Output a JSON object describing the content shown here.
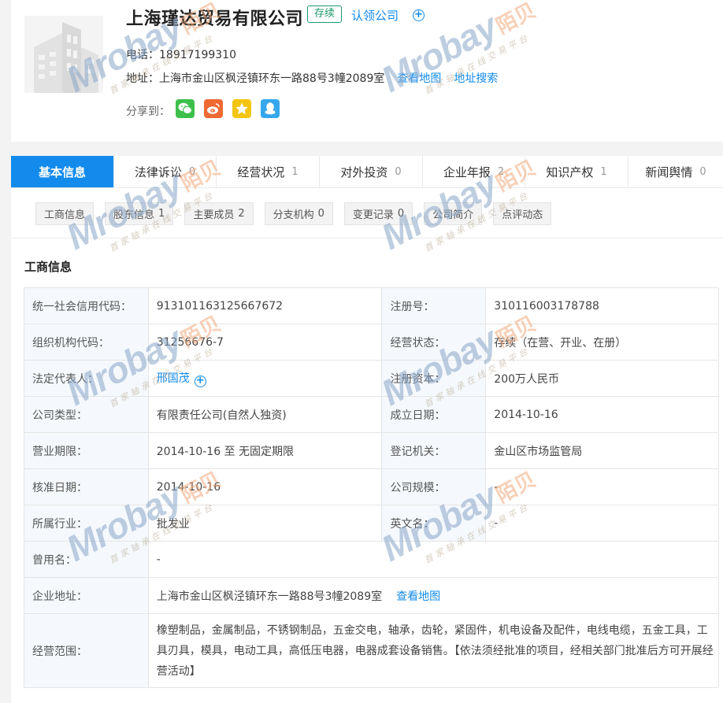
{
  "company": {
    "name": "上海瑾达贸易有限公司",
    "status_tag": "存续",
    "claim_label": "认领公司",
    "phone_label": "电话：",
    "phone": "18917199310",
    "address_label": "地址：",
    "address": "上海市金山区枫泾镇环东一路88号3幢2089室",
    "view_map": "查看地图",
    "address_search": "地址搜索",
    "share_label": "分享到："
  },
  "share_icons": [
    "wechat-icon",
    "weibo-icon",
    "qzone-icon",
    "qq-icon"
  ],
  "tabs": [
    {
      "label": "基本信息",
      "count": ""
    },
    {
      "label": "法律诉讼",
      "count": "0"
    },
    {
      "label": "经营状况",
      "count": "1"
    },
    {
      "label": "对外投资",
      "count": "0"
    },
    {
      "label": "企业年报",
      "count": "2"
    },
    {
      "label": "知识产权",
      "count": "1"
    },
    {
      "label": "新闻舆情",
      "count": "0"
    }
  ],
  "subtabs": [
    {
      "label": "工商信息",
      "count": ""
    },
    {
      "label": "股东信息",
      "count": "1"
    },
    {
      "label": "主要成员",
      "count": "2"
    },
    {
      "label": "分支机构",
      "count": "0"
    },
    {
      "label": "变更记录",
      "count": "0"
    },
    {
      "label": "公司简介",
      "count": ""
    },
    {
      "label": "点评动态",
      "count": ""
    }
  ],
  "section_title": "工商信息",
  "info": {
    "credit_code_label": "统一社会信用代码：",
    "credit_code": "913101163125667672",
    "reg_no_label": "注册号：",
    "reg_no": "310116003178788",
    "org_code_label": "组织机构代码：",
    "org_code": "31256676-7",
    "biz_status_label": "经营状态：",
    "biz_status": "存续（在营、开业、在册）",
    "legal_rep_label": "法定代表人：",
    "legal_rep": "邢国茂",
    "reg_capital_label": "注册资本：",
    "reg_capital": "200万人民币",
    "company_type_label": "公司类型：",
    "company_type": "有限责任公司(自然人独资)",
    "founded_label": "成立日期：",
    "founded": "2014-10-16",
    "term_label": "营业期限：",
    "term": "2014-10-16 至 无固定期限",
    "authority_label": "登记机关：",
    "authority": "金山区市场监管局",
    "approval_label": "核准日期：",
    "approval": "2014-10-16",
    "scale_label": "公司规模：",
    "scale": "-",
    "industry_label": "所属行业：",
    "industry": "批发业",
    "english_name_label": "英文名：",
    "english_name": "-",
    "former_name_label": "曾用名：",
    "former_name": "-",
    "address_label": "企业地址：",
    "address": "上海市金山区枫泾镇环东一路88号3幢2089室",
    "view_map": "查看地图",
    "scope_label": "经营范围：",
    "scope": "橡塑制品，金属制品，不锈钢制品，五金交电，轴承，齿轮，紧固件，机电设备及配件，电线电缆，五金工具，工具刃具，模具，电动工具，高低压电器，电器成套设备销售。【依法须经批准的项目，经相关部门批准后方可开展经营活动】"
  },
  "watermark": {
    "brand": "Mrobay",
    "brand_cn": "陌贝",
    "tagline": "首家轴承在线交易平台"
  },
  "colors": {
    "accent": "#128bed",
    "status_green": "#1c9a6b",
    "label_bg": "#f5f9fd"
  }
}
